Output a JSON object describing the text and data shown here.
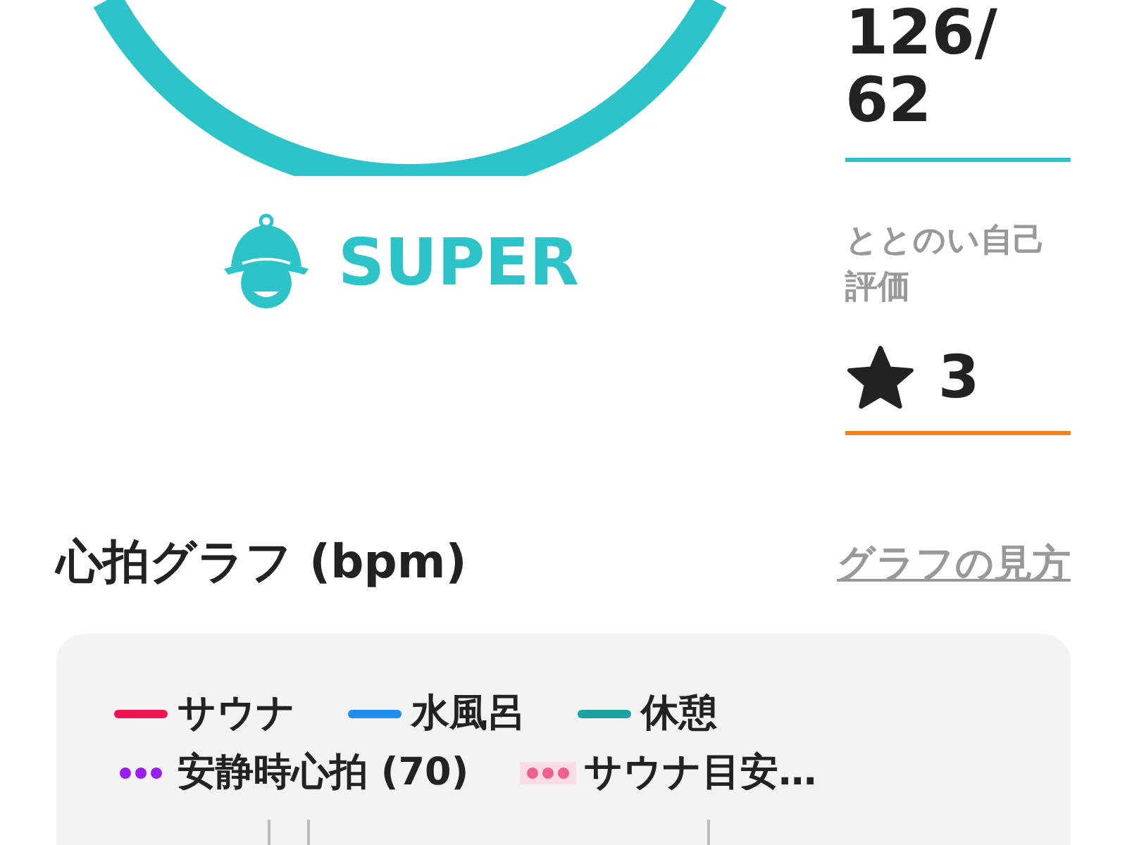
{
  "blood_pressure": {
    "lines": [
      "126/",
      "62"
    ]
  },
  "level_badge": {
    "label": "SUPER"
  },
  "self_rating": {
    "label": "ととのい自己評価",
    "value": "3"
  },
  "heart_rate_graph": {
    "title": "心拍グラフ (bpm)",
    "help_link": "グラフの見方",
    "legend": [
      {
        "label": "サウナ",
        "kind": "solid",
        "color": "#f0134f",
        "highlighted": false
      },
      {
        "label": "水風呂",
        "kind": "solid",
        "color": "#1e8ff0",
        "highlighted": false
      },
      {
        "label": "休憩",
        "kind": "solid",
        "color": "#1aa3a0",
        "highlighted": false
      },
      {
        "label": "安静時心拍 (70)",
        "kind": "dotted",
        "color": "#9a1ef0",
        "highlighted": false
      },
      {
        "label": "サウナ目安…",
        "kind": "dotted",
        "color": "#f0608c",
        "highlighted": true
      }
    ]
  }
}
